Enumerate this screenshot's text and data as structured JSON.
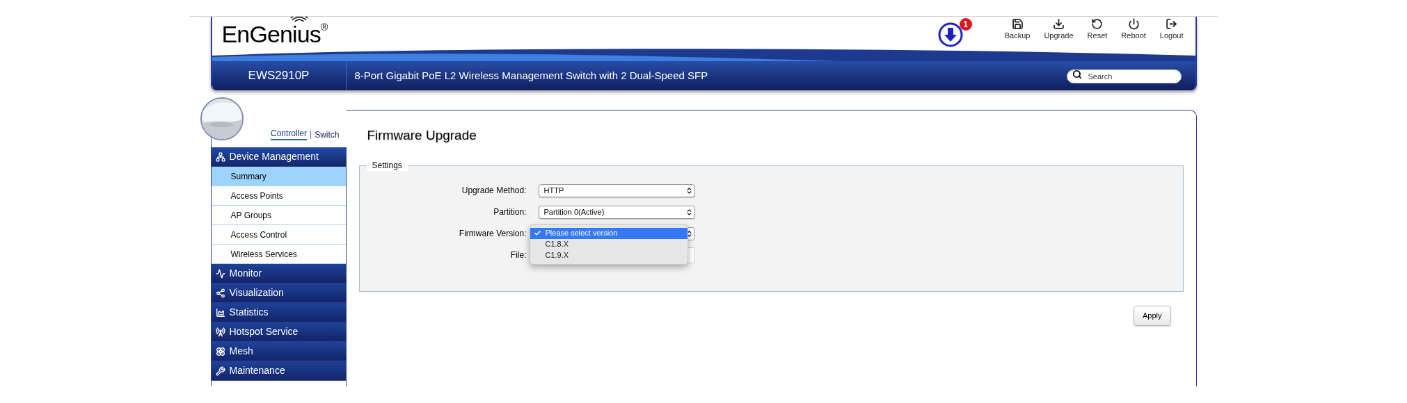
{
  "header": {
    "logo": "EnGenius",
    "logo_mark": "®",
    "notification": {
      "count": "1"
    },
    "toolbar": [
      {
        "kind": "backup",
        "label": "Backup"
      },
      {
        "kind": "upgrade",
        "label": "Upgrade"
      },
      {
        "kind": "reset",
        "label": "Reset"
      },
      {
        "kind": "reboot",
        "label": "Reboot"
      },
      {
        "kind": "logout",
        "label": "Logout"
      }
    ],
    "model": "EWS2910P",
    "description": "8-Port Gigabit PoE L2 Wireless Management Switch with 2 Dual-Speed SFP",
    "search": {
      "placeholder": "Search"
    }
  },
  "sidebar": {
    "modes": [
      {
        "label": "Controller",
        "selected": true
      },
      {
        "label": "Switch",
        "selected": false
      }
    ],
    "mode_separator": "|",
    "menu": [
      {
        "kind": "device",
        "label": "Device Management",
        "expanded": true,
        "children": [
          {
            "label": "Summary",
            "selected": true
          },
          {
            "label": "Access Points",
            "selected": false
          },
          {
            "label": "AP Groups",
            "selected": false
          },
          {
            "label": "Access Control",
            "selected": false
          },
          {
            "label": "Wireless Services",
            "selected": false
          }
        ]
      },
      {
        "kind": "monitor",
        "label": "Monitor",
        "expanded": false
      },
      {
        "kind": "share",
        "label": "Visualization",
        "expanded": false
      },
      {
        "kind": "chart",
        "label": "Statistics",
        "expanded": false
      },
      {
        "kind": "antenna",
        "label": "Hotspot Service",
        "expanded": false
      },
      {
        "kind": "mesh",
        "label": "Mesh",
        "expanded": false
      },
      {
        "kind": "wrench",
        "label": "Maintenance",
        "expanded": false
      }
    ]
  },
  "content": {
    "title": "Firmware Upgrade",
    "legend": "Settings",
    "fields": [
      {
        "kind": "select",
        "label": "Upgrade Method:",
        "value": "HTTP"
      },
      {
        "kind": "select",
        "label": "Partition:",
        "value": "Partition 0(Active)"
      },
      {
        "kind": "dropdown",
        "label": "Firmware Version:",
        "options": [
          {
            "label": "Please select version",
            "selected": true
          },
          {
            "label": "C1.8.X",
            "selected": false
          },
          {
            "label": "C1.9.X",
            "selected": false
          }
        ]
      },
      {
        "kind": "file",
        "label": "File:"
      }
    ],
    "apply": "Apply"
  }
}
